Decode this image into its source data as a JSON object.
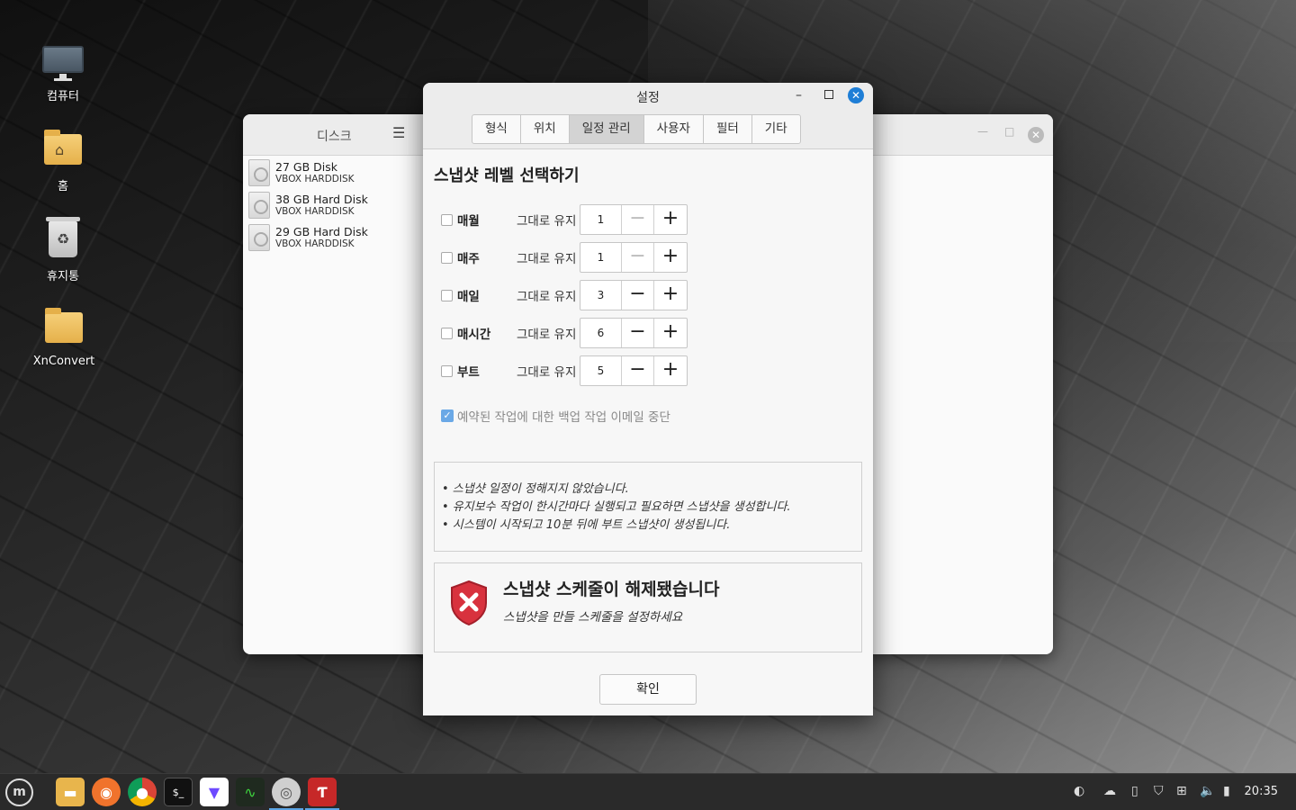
{
  "desktop": {
    "icons": [
      {
        "label": "컴퓨터"
      },
      {
        "label": "홈"
      },
      {
        "label": "휴지통"
      },
      {
        "label": "XnConvert"
      }
    ]
  },
  "disk_window": {
    "sidebar_title": "디스크",
    "disks": [
      {
        "name": "27 GB Disk",
        "sub": "VBOX HARDDISK"
      },
      {
        "name": "38 GB Hard Disk",
        "sub": "VBOX HARDDISK"
      },
      {
        "name": "29 GB Hard Disk",
        "sub": "VBOX HARDDISK"
      }
    ]
  },
  "dialog": {
    "title": "설정",
    "tabs": [
      "형식",
      "위치",
      "일정 관리",
      "사용자",
      "필터",
      "기타"
    ],
    "active_tab": "일정 관리",
    "section_title": "스냅샷 레벨 선택하기",
    "keep_label": "그대로 유지",
    "levels": [
      {
        "label": "매월",
        "value": "1",
        "checked": false
      },
      {
        "label": "매주",
        "value": "1",
        "checked": false
      },
      {
        "label": "매일",
        "value": "3",
        "checked": false
      },
      {
        "label": "매시간",
        "value": "6",
        "checked": false
      },
      {
        "label": "부트",
        "value": "5",
        "checked": false
      }
    ],
    "email_option": {
      "label": "예약된 작업에 대한 백업 작업 이메일 중단",
      "checked": true
    },
    "notes": [
      "• 스냅샷 일정이 정해지지 않았습니다.",
      "• 유지보수 작업이 한시간마다 실행되고 필요하면 스냅샷을 생성합니다.",
      "• 시스템이 시작되고 10분 뒤에 부트 스냅샷이 생성됩니다."
    ],
    "alert": {
      "title": "스냅샷 스케줄이 해제됐습니다",
      "subtitle": "스냅샷을 만들 스케줄을 설정하세요"
    },
    "ok_label": "확인"
  },
  "taskbar": {
    "apps": [
      "files",
      "firefox",
      "chrome",
      "terminal",
      "proton-vpn",
      "system-monitor",
      "disks",
      "timeshift"
    ],
    "clock": "20:35"
  }
}
